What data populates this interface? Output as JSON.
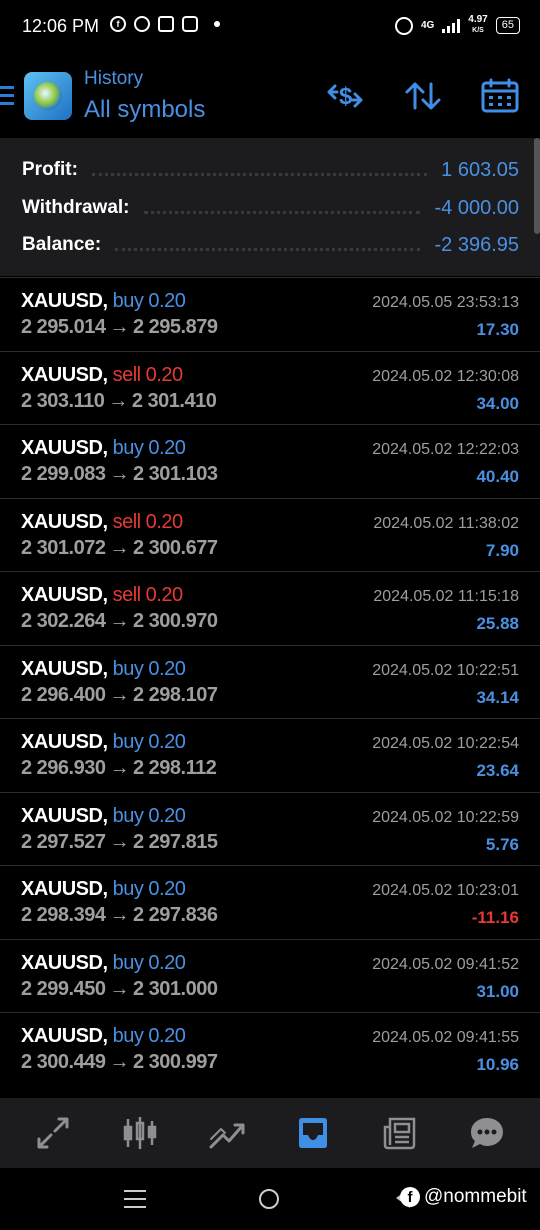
{
  "status_bar": {
    "time": "12:06 PM",
    "network": "4G",
    "speed_value": "4.97",
    "speed_unit": "K/S",
    "battery": "65"
  },
  "header": {
    "subtitle": "History",
    "title": "All symbols",
    "icons": [
      "currency-exchange-icon",
      "sort-icon",
      "calendar-icon"
    ]
  },
  "summary": {
    "profit_label": "Profit:",
    "profit_value": "1 603.05",
    "withdrawal_label": "Withdrawal:",
    "withdrawal_value": "-4 000.00",
    "balance_label": "Balance:",
    "balance_value": "-2 396.95"
  },
  "trades": [
    {
      "symbol": "XAUUSD,",
      "side": "buy",
      "volume": "0.20",
      "open": "2 295.014",
      "close": "2 295.879",
      "datetime": "2024.05.05 23:53:13",
      "profit": "17.30"
    },
    {
      "symbol": "XAUUSD,",
      "side": "sell",
      "volume": "0.20",
      "open": "2 303.110",
      "close": "2 301.410",
      "datetime": "2024.05.02 12:30:08",
      "profit": "34.00"
    },
    {
      "symbol": "XAUUSD,",
      "side": "buy",
      "volume": "0.20",
      "open": "2 299.083",
      "close": "2 301.103",
      "datetime": "2024.05.02 12:22:03",
      "profit": "40.40"
    },
    {
      "symbol": "XAUUSD,",
      "side": "sell",
      "volume": "0.20",
      "open": "2 301.072",
      "close": "2 300.677",
      "datetime": "2024.05.02 11:38:02",
      "profit": "7.90"
    },
    {
      "symbol": "XAUUSD,",
      "side": "sell",
      "volume": "0.20",
      "open": "2 302.264",
      "close": "2 300.970",
      "datetime": "2024.05.02 11:15:18",
      "profit": "25.88"
    },
    {
      "symbol": "XAUUSD,",
      "side": "buy",
      "volume": "0.20",
      "open": "2 296.400",
      "close": "2 298.107",
      "datetime": "2024.05.02 10:22:51",
      "profit": "34.14"
    },
    {
      "symbol": "XAUUSD,",
      "side": "buy",
      "volume": "0.20",
      "open": "2 296.930",
      "close": "2 298.112",
      "datetime": "2024.05.02 10:22:54",
      "profit": "23.64"
    },
    {
      "symbol": "XAUUSD,",
      "side": "buy",
      "volume": "0.20",
      "open": "2 297.527",
      "close": "2 297.815",
      "datetime": "2024.05.02 10:22:59",
      "profit": "5.76"
    },
    {
      "symbol": "XAUUSD,",
      "side": "buy",
      "volume": "0.20",
      "open": "2 298.394",
      "close": "2 297.836",
      "datetime": "2024.05.02 10:23:01",
      "profit": "-11.16"
    },
    {
      "symbol": "XAUUSD,",
      "side": "buy",
      "volume": "0.20",
      "open": "2 299.450",
      "close": "2 301.000",
      "datetime": "2024.05.02 09:41:52",
      "profit": "31.00"
    },
    {
      "symbol": "XAUUSD,",
      "side": "buy",
      "volume": "0.20",
      "open": "2 300.449",
      "close": "2 300.997",
      "datetime": "2024.05.02 09:41:55",
      "profit": "10.96"
    }
  ],
  "price_arrow": "→",
  "tab_bar": {
    "tabs": [
      "quotes-icon",
      "chart-icon",
      "trade-icon",
      "history-icon",
      "news-icon",
      "messages-icon"
    ],
    "active_index": 3
  },
  "watermark": {
    "text": "@nommebit",
    "fb_glyph": "f"
  },
  "colors": {
    "accent": "#4a90e2",
    "sell": "#e53935",
    "muted": "#9e9e9e"
  }
}
